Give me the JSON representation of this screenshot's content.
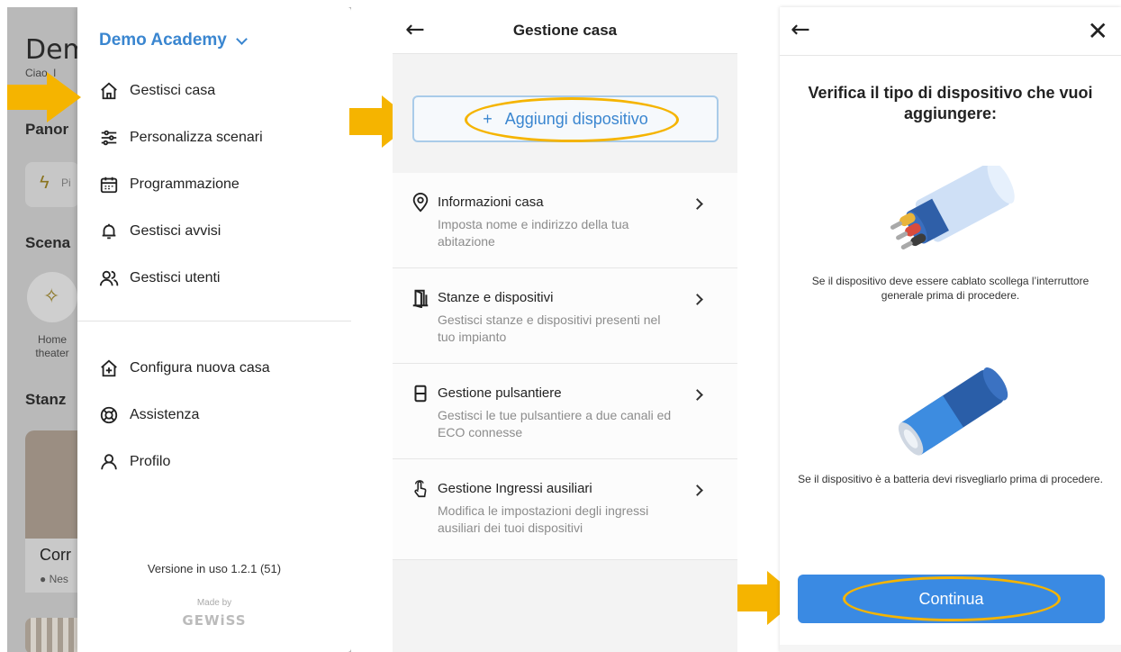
{
  "colors": {
    "accent": "#3a86d0",
    "highlight": "#f5b400",
    "button": "#3a8ae3"
  },
  "background_app": {
    "title": "Dem",
    "greeting": "Ciao, l",
    "section1": "Panor",
    "chip": "Pi",
    "section2": "Scena",
    "scene_label": "Home theater",
    "section3": "Stanz",
    "room_name": "Corr",
    "room_status": "● Nes"
  },
  "drawer": {
    "home_name": "Demo Academy",
    "items": [
      {
        "label": "Gestisci casa",
        "icon": "home-icon"
      },
      {
        "label": "Personalizza scenari",
        "icon": "sliders-icon"
      },
      {
        "label": "Programmazione",
        "icon": "calendar-icon"
      },
      {
        "label": "Gestisci avvisi",
        "icon": "bell-icon"
      },
      {
        "label": "Gestisci utenti",
        "icon": "users-icon"
      }
    ],
    "secondary": [
      {
        "label": "Configura nuova casa",
        "icon": "new-home-icon"
      },
      {
        "label": "Assistenza",
        "icon": "lifebuoy-icon"
      },
      {
        "label": "Profilo",
        "icon": "user-icon"
      }
    ],
    "version": "Versione in uso 1.2.1 (51)",
    "made_by": "Made by",
    "brand": "GEWiSS"
  },
  "gestione_casa": {
    "title": "Gestione casa",
    "add_button": "Aggiungi dispositivo",
    "add_plus": "+",
    "rows": [
      {
        "title": "Informazioni casa",
        "desc": "Imposta nome e indirizzo della tua abitazione",
        "icon": "location-pin-icon"
      },
      {
        "title": "Stanze e dispositivi",
        "desc": "Gestisci stanze e dispositivi presenti nel tuo impianto",
        "icon": "door-icon"
      },
      {
        "title": "Gestione pulsantiere",
        "desc": "Gestisci le tue pulsantiere a due canali ed ECO connesse",
        "icon": "switch-panel-icon"
      },
      {
        "title": "Gestione Ingressi ausiliari",
        "desc": "Modifica le impostazioni degli ingressi ausiliari dei tuoi dispositivi",
        "icon": "touch-icon"
      }
    ]
  },
  "verifica": {
    "question": "Verifica il tipo di dispositivo che vuoi aggiungere:",
    "cable_text": "Se il dispositivo deve essere cablato scollega l’interruttore generale prima di procedere.",
    "battery_text": "Se il dispositivo è a batteria devi risvegliarlo prima di procedere.",
    "continue_button": "Continua"
  }
}
